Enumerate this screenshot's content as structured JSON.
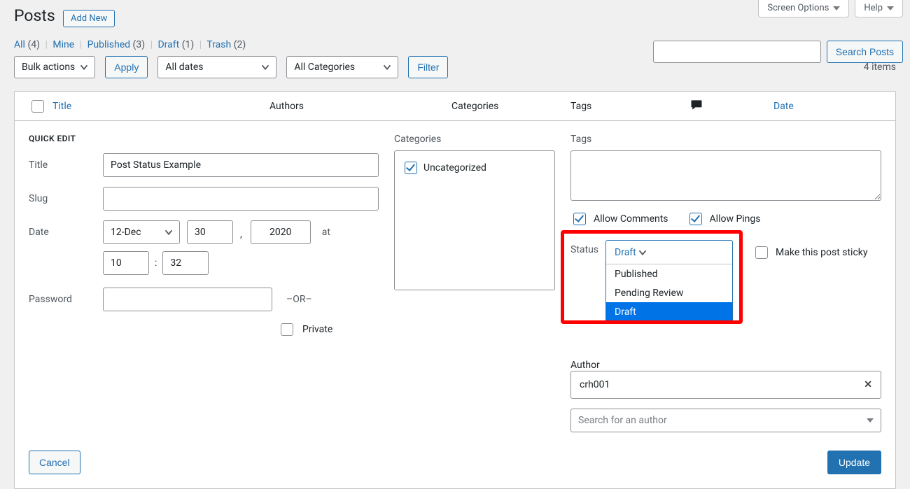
{
  "topbar": {
    "screen_options": "Screen Options",
    "help": "Help"
  },
  "heading": "Posts",
  "add_new": "Add New",
  "views": {
    "all": {
      "label": "All",
      "count": "(4)"
    },
    "mine": {
      "label": "Mine"
    },
    "published": {
      "label": "Published",
      "count": "(3)"
    },
    "draft": {
      "label": "Draft",
      "count": "(1)"
    },
    "trash": {
      "label": "Trash",
      "count": "(2)"
    }
  },
  "search": {
    "button": "Search Posts"
  },
  "filters": {
    "bulk": "Bulk actions",
    "apply": "Apply",
    "dates": "All dates",
    "cats": "All Categories",
    "filter": "Filter",
    "items": "4 items"
  },
  "columns": {
    "title": "Title",
    "authors": "Authors",
    "categories": "Categories",
    "tags": "Tags",
    "date": "Date"
  },
  "quick_edit": {
    "legend": "QUICK EDIT",
    "title_lbl": "Title",
    "title_val": "Post Status Example",
    "slug_lbl": "Slug",
    "slug_val": "",
    "date_lbl": "Date",
    "month": "12-Dec",
    "day": "30",
    "year": "2020",
    "at": "at",
    "hour": "10",
    "minute": "32",
    "colon": ":",
    "comma": ",",
    "password_lbl": "Password",
    "password_val": "",
    "or": "–OR–",
    "private": "Private",
    "categories_head": "Categories",
    "cat_uncat": "Uncategorized",
    "tags_head": "Tags",
    "allow_comments": "Allow Comments",
    "allow_pings": "Allow Pings",
    "status_lbl": "Status",
    "status_sel": "Draft",
    "status_opts": [
      "Published",
      "Pending Review",
      "Draft"
    ],
    "sticky": "Make this post sticky",
    "author_lbl": "Author",
    "author_val": "crh001",
    "author_search_ph": "Search for an author",
    "cancel": "Cancel",
    "update": "Update"
  }
}
